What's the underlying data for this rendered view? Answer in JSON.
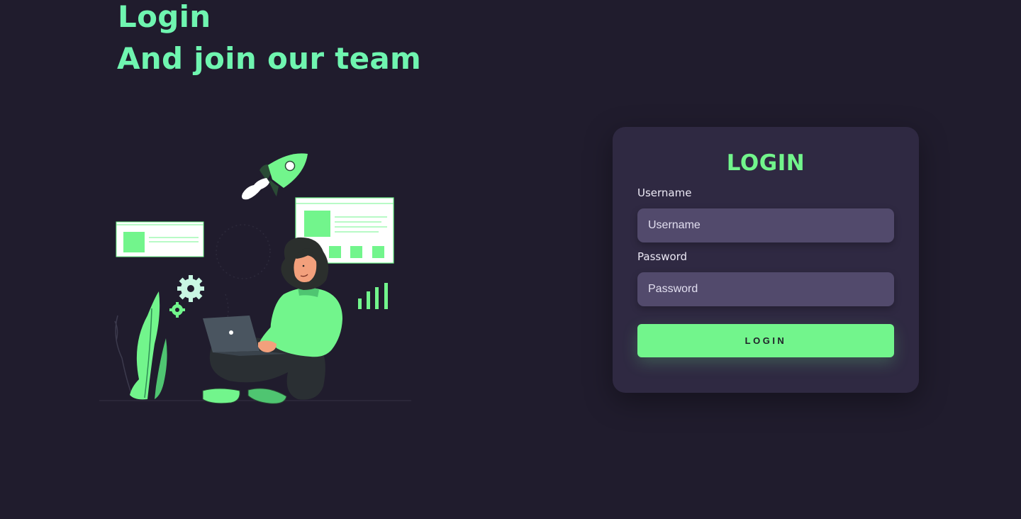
{
  "hero": {
    "line1": "Login",
    "line2": "And join our team"
  },
  "illustration": {
    "icon": "person-with-laptop-illustration"
  },
  "login_form": {
    "title": "LOGIN",
    "username_label": "Username",
    "username_placeholder": "Username",
    "username_value": "",
    "password_label": "Password",
    "password_placeholder": "Password",
    "password_value": "",
    "submit_label": "LOGIN"
  },
  "colors": {
    "background": "#201c2d",
    "accent": "#72f58c",
    "heading": "#6ff5b0",
    "card": "#2f2942",
    "input": "#524a6c"
  }
}
